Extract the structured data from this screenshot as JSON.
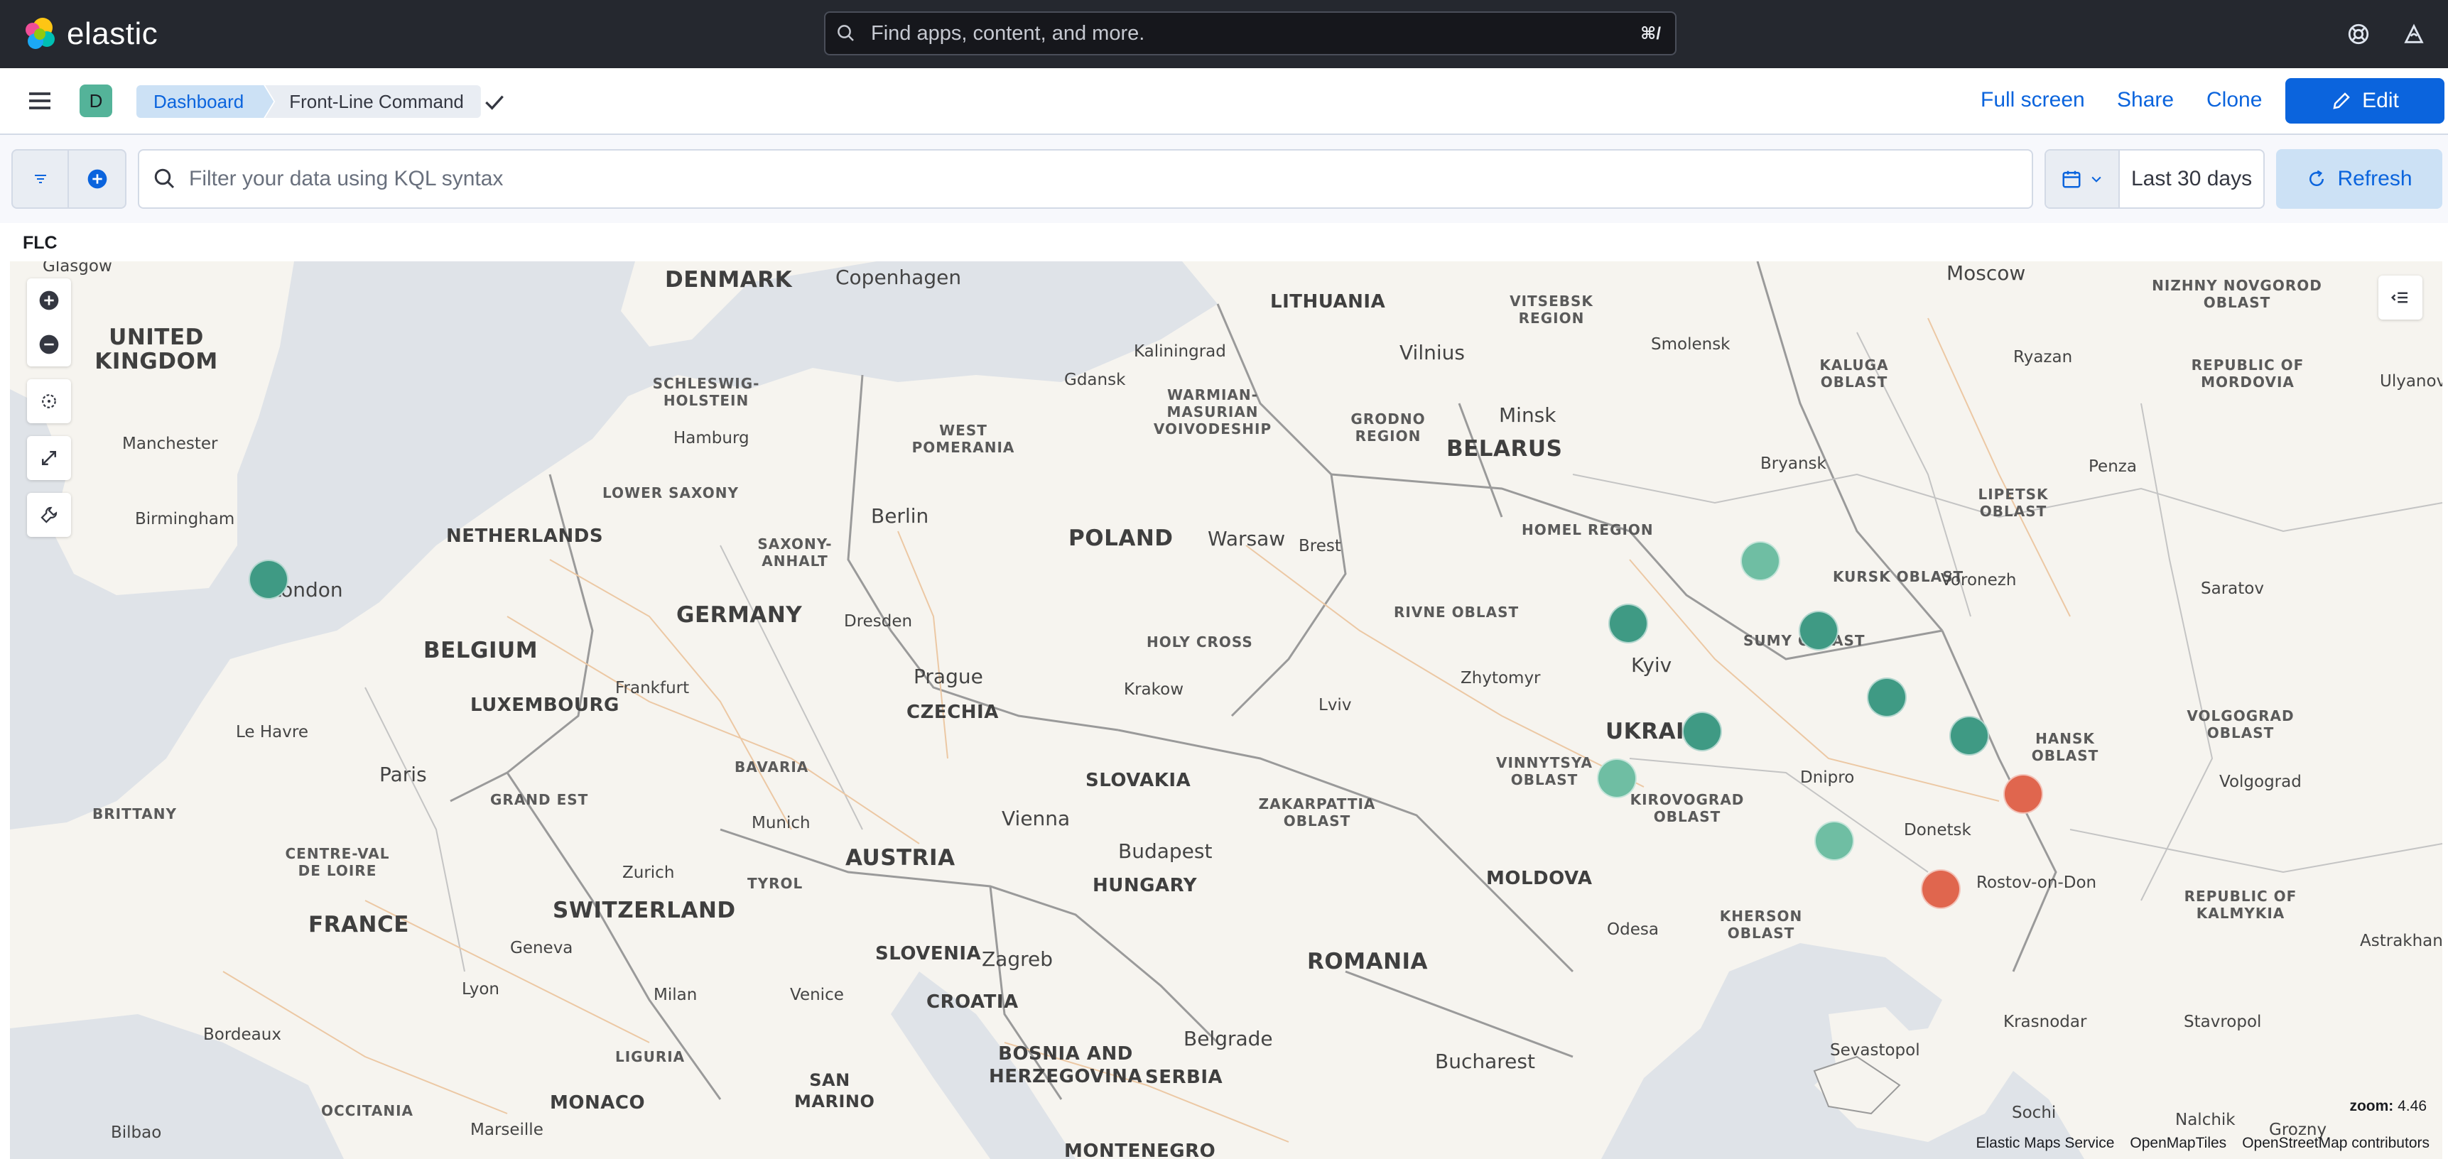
{
  "header": {
    "brand": "elastic",
    "search_placeholder": "Find apps, content, and more.",
    "search_shortcut": "⌘/"
  },
  "dashbar": {
    "space_initial": "D",
    "breadcrumbs": [
      "Dashboard",
      "Front-Line Command"
    ],
    "actions": {
      "full_screen": "Full screen",
      "share": "Share",
      "clone": "Clone",
      "edit": "Edit"
    }
  },
  "filterbar": {
    "query_placeholder": "Filter your data using KQL syntax",
    "date_range": "Last 30 days",
    "refresh": "Refresh"
  },
  "panel": {
    "title": "FLC",
    "map": {
      "zoom_label": "zoom:",
      "zoom_value": "4.46",
      "attribution": [
        "Elastic Maps Service",
        "OpenMapTiles",
        "OpenStreetMap contributors"
      ],
      "countries": [
        "DENMARK",
        "UNITED KINGDOM",
        "NETHERLANDS",
        "BELGIUM",
        "LUXEMBOURG",
        "GERMANY",
        "POLAND",
        "BELARUS",
        "LITHUANIA",
        "CZECHIA",
        "SLOVAKIA",
        "AUSTRIA",
        "SWITZERLAND",
        "FRANCE",
        "HUNGARY",
        "SLOVENIA",
        "CROATIA",
        "ROMANIA",
        "MOLDOVA",
        "UKRAI",
        "BOSNIA AND HERZEGOVINA",
        "SERBIA",
        "SAN MARINO",
        "MONACO",
        "MONTENEGRO"
      ],
      "regions": [
        "SCHLESWIG-HOLSTEIN",
        "LOWER SAXONY",
        "SAXONY-ANHALT",
        "WEST POMERANIA",
        "WARMIAN-MASURIAN VOIVODESHIP",
        "GRODNO REGION",
        "VITSEBSK REGION",
        "HOMEL REGION",
        "HOLY CROSS",
        "RIVNE OBLAST",
        "KALUGA OBLAST",
        "KURSK OBLAST",
        "LIPETSK OBLAST",
        "SUMY OBLAST",
        "VINNYTSYA OBLAST",
        "KIROVOGRAD OBLAST",
        "ZAKARPATTIA OBLAST",
        "KHERSON OBLAST",
        "NIZHNY NOVGOROD OBLAST",
        "REPUBLIC OF MORDOVIA",
        "VOLGOGRAD OBLAST",
        "REPUBLIC OF KALMYKIA",
        "BAVARIA",
        "GRAND EST",
        "BRITTANY",
        "CENTRE-VAL DE LOIRE",
        "TYROL",
        "LIGURIA",
        "OCCITANIA",
        "HANSK OBLAST"
      ],
      "cities": [
        "Glasgow",
        "Copenhagen",
        "Kaliningrad",
        "Gdansk",
        "Vilnius",
        "Minsk",
        "Moscow",
        "Smolensk",
        "Ryazan",
        "Ulyanovs",
        "Manchester",
        "Birmingham",
        "London",
        "Hamburg",
        "Berlin",
        "Warsaw",
        "Brest",
        "Bryansk",
        "Penza",
        "Dresden",
        "Frankfurt",
        "Prague",
        "Krakow",
        "Zhytomyr",
        "Kyiv",
        "Voronezh",
        "Saratov",
        "Le Havre",
        "Paris",
        "Lviv",
        "Munich",
        "Vienna",
        "Budapest",
        "Dnipro",
        "Donetsk",
        "Volgograd",
        "Zurich",
        "Geneva",
        "Lyon",
        "Milan",
        "Venice",
        "Zagreb",
        "Odesa",
        "Rostov-on-Don",
        "Astrakhan",
        "Bordeaux",
        "Belgrade",
        "Bucharest",
        "Krasnodar",
        "Stavropol",
        "Sevastopol",
        "Marseille",
        "Bilbao",
        "Sochi",
        "Nalchik",
        "Grozny"
      ]
    }
  },
  "colors": {
    "header_bg": "#25282f",
    "primary": "#0b64dd",
    "dot_dark": "#3f9a84",
    "dot_light": "#6fbea3",
    "dot_red": "#e0664e"
  }
}
